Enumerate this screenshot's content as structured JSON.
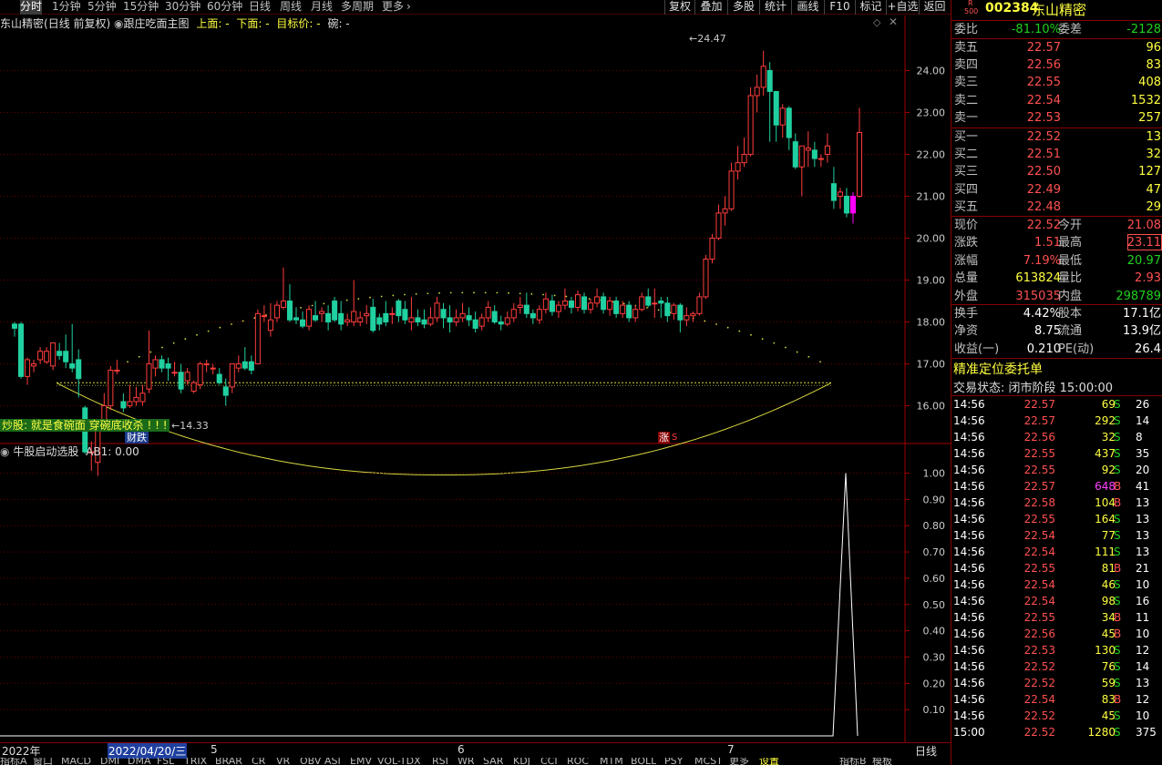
{
  "toolbar": {
    "periods": [
      "分时",
      "1分钟",
      "5分钟",
      "15分钟",
      "30分钟",
      "60分钟",
      "日线",
      "周线",
      "月线",
      "多周期",
      "更多"
    ],
    "buttons": [
      "复权",
      "叠加",
      "多股",
      "统计",
      "画线",
      "F10",
      "标记",
      "+自选",
      "返回"
    ]
  },
  "chart_header": {
    "stock_name": "东山精密",
    "mode": "(日线 前复权)",
    "indicator": "跟庄吃面主图",
    "upper": "上面: -",
    "lower": "下面: -",
    "target": "目标价: -",
    "bowl": "碗: -"
  },
  "chart_data": {
    "type": "candlestick",
    "ylim": [
      15.1,
      24.9
    ],
    "y_ticks": [
      "24.00",
      "23.00",
      "22.00",
      "21.00",
      "20.00",
      "19.00",
      "18.00",
      "17.00",
      "16.00"
    ],
    "y_tick_values": [
      24,
      23,
      22,
      21,
      20,
      19,
      18,
      17,
      16
    ],
    "max_label": "24.47",
    "min_label": "14.33",
    "candles": [
      [
        17.95,
        17.85,
        18.0,
        17.65
      ],
      [
        17.95,
        16.7,
        18.0,
        16.65
      ],
      [
        16.7,
        17.1,
        17.15,
        16.5
      ],
      [
        16.95,
        17.0,
        17.1,
        16.8
      ],
      [
        17.1,
        17.3,
        17.4,
        17.0
      ],
      [
        17.05,
        17.3,
        17.4,
        17.0
      ],
      [
        16.95,
        17.5,
        17.5,
        16.85
      ],
      [
        17.3,
        17.2,
        17.5,
        17.1
      ],
      [
        17.3,
        17.05,
        17.7,
        16.9
      ],
      [
        17.0,
        16.9,
        17.95,
        16.8
      ],
      [
        17.1,
        16.65,
        17.35,
        16.2
      ],
      [
        15.95,
        14.9,
        16.0,
        14.85
      ],
      [
        14.9,
        14.9,
        15.15,
        14.45
      ],
      [
        14.65,
        15.5,
        15.55,
        14.33
      ],
      [
        15.5,
        16.0,
        16.3,
        15.4
      ],
      [
        16.0,
        16.85,
        16.95,
        15.9
      ],
      [
        16.85,
        16.85,
        17.1,
        16.75
      ],
      [
        16.1,
        15.95,
        16.3,
        15.85
      ],
      [
        16.0,
        16.1,
        16.5,
        15.95
      ],
      [
        16.1,
        16.2,
        16.45,
        16.0
      ],
      [
        16.1,
        16.3,
        16.5,
        16.0
      ],
      [
        16.4,
        17.0,
        17.8,
        16.3
      ],
      [
        16.9,
        17.1,
        17.2,
        16.7
      ],
      [
        17.1,
        16.9,
        17.2,
        16.8
      ],
      [
        17.0,
        16.9,
        17.15,
        16.6
      ],
      [
        16.8,
        16.8,
        17.05,
        16.7
      ],
      [
        16.8,
        16.4,
        17.0,
        16.3
      ],
      [
        16.6,
        16.8,
        16.9,
        16.5
      ],
      [
        16.35,
        16.55,
        16.6,
        16.3
      ],
      [
        16.5,
        17.0,
        17.05,
        16.4
      ],
      [
        17.0,
        17.0,
        17.1,
        16.8
      ],
      [
        16.9,
        16.9,
        17.0,
        16.75
      ],
      [
        16.75,
        16.55,
        16.9,
        16.5
      ],
      [
        16.45,
        16.25,
        16.65,
        16.0
      ],
      [
        16.45,
        17.0,
        17.0,
        16.3
      ],
      [
        16.9,
        17.0,
        17.2,
        16.8
      ],
      [
        17.05,
        16.9,
        17.4,
        16.85
      ],
      [
        17.05,
        16.85,
        17.2,
        16.75
      ],
      [
        17.0,
        18.2,
        18.3,
        17.0
      ],
      [
        18.15,
        18.15,
        18.4,
        18.0
      ],
      [
        17.8,
        18.05,
        18.45,
        17.65
      ],
      [
        18.1,
        18.4,
        18.5,
        18.0
      ],
      [
        18.35,
        18.5,
        19.3,
        18.3
      ],
      [
        18.5,
        18.05,
        18.9,
        18.0
      ],
      [
        18.1,
        18.05,
        18.35,
        17.95
      ],
      [
        18.05,
        17.9,
        18.25,
        17.85
      ],
      [
        17.9,
        18.3,
        18.4,
        17.8
      ],
      [
        18.15,
        18.05,
        18.5,
        18.0
      ],
      [
        18.2,
        18.25,
        18.35,
        18.0
      ],
      [
        18.2,
        18.0,
        18.4,
        17.8
      ],
      [
        18.5,
        18.05,
        18.6,
        18.0
      ],
      [
        18.2,
        17.95,
        18.5,
        17.8
      ],
      [
        18.0,
        18.05,
        18.2,
        17.9
      ],
      [
        18.0,
        18.25,
        19.0,
        17.9
      ],
      [
        18.0,
        18.1,
        18.25,
        17.9
      ],
      [
        18.15,
        18.2,
        18.4,
        17.95
      ],
      [
        18.35,
        17.8,
        18.55,
        17.75
      ],
      [
        18.1,
        17.95,
        18.2,
        17.8
      ],
      [
        18.2,
        18.0,
        18.5,
        17.9
      ],
      [
        18.2,
        18.2,
        18.35,
        17.95
      ],
      [
        18.5,
        18.15,
        18.55,
        18.0
      ],
      [
        18.3,
        18.05,
        18.5,
        17.95
      ],
      [
        18.0,
        18.1,
        18.6,
        17.8
      ],
      [
        18.1,
        18.0,
        18.3,
        17.9
      ],
      [
        18.05,
        17.95,
        18.3,
        17.85
      ],
      [
        17.95,
        18.1,
        18.35,
        17.9
      ],
      [
        18.1,
        18.45,
        18.6,
        18.0
      ],
      [
        18.3,
        18.1,
        18.45,
        17.85
      ],
      [
        18.1,
        18.0,
        18.4,
        17.75
      ],
      [
        18.0,
        18.1,
        18.3,
        17.9
      ],
      [
        18.1,
        18.2,
        18.45,
        18.0
      ],
      [
        18.15,
        18.05,
        18.35,
        17.9
      ],
      [
        18.05,
        17.85,
        18.25,
        17.75
      ],
      [
        17.9,
        18.1,
        18.2,
        17.8
      ],
      [
        18.1,
        18.35,
        18.5,
        18.0
      ],
      [
        18.25,
        18.0,
        18.4,
        17.95
      ],
      [
        18.0,
        17.95,
        18.15,
        17.8
      ],
      [
        17.95,
        18.1,
        18.25,
        17.9
      ],
      [
        18.1,
        18.3,
        18.45,
        18.0
      ],
      [
        18.35,
        18.4,
        18.6,
        18.2
      ],
      [
        18.4,
        18.2,
        18.7,
        18.1
      ],
      [
        18.2,
        18.1,
        18.3,
        17.95
      ],
      [
        18.05,
        18.3,
        18.4,
        17.95
      ],
      [
        18.3,
        18.55,
        18.7,
        18.2
      ],
      [
        18.5,
        18.25,
        18.65,
        18.15
      ],
      [
        18.25,
        18.4,
        18.5,
        18.1
      ],
      [
        18.4,
        18.5,
        18.8,
        18.3
      ],
      [
        18.5,
        18.35,
        18.6,
        18.2
      ],
      [
        18.35,
        18.65,
        18.75,
        18.25
      ],
      [
        18.6,
        18.3,
        18.7,
        18.2
      ],
      [
        18.3,
        18.45,
        18.55,
        18.2
      ],
      [
        18.45,
        18.6,
        18.8,
        18.35
      ],
      [
        18.6,
        18.3,
        18.7,
        18.2
      ],
      [
        18.3,
        18.5,
        18.6,
        18.15
      ],
      [
        18.5,
        18.2,
        18.6,
        18.1
      ],
      [
        18.2,
        18.4,
        18.5,
        18.1
      ],
      [
        18.4,
        18.1,
        18.5,
        18.0
      ],
      [
        18.1,
        18.3,
        18.4,
        18.0
      ],
      [
        18.3,
        18.6,
        18.7,
        18.25
      ],
      [
        18.6,
        18.4,
        18.8,
        18.35
      ],
      [
        18.45,
        18.45,
        18.8,
        18.1
      ],
      [
        18.5,
        18.45,
        18.6,
        18.1
      ],
      [
        18.45,
        18.15,
        18.6,
        18.0
      ],
      [
        18.2,
        18.4,
        18.45,
        18.05
      ],
      [
        18.4,
        18.05,
        18.45,
        17.75
      ],
      [
        18.05,
        18.15,
        18.35,
        17.9
      ],
      [
        18.15,
        18.2,
        18.25,
        18.0
      ],
      [
        18.2,
        18.6,
        18.7,
        18.15
      ],
      [
        18.6,
        19.5,
        19.6,
        18.55
      ],
      [
        19.5,
        20.0,
        20.1,
        19.4
      ],
      [
        20.0,
        20.6,
        20.8,
        19.95
      ],
      [
        20.6,
        20.7,
        21.0,
        20.3
      ],
      [
        20.7,
        21.6,
        21.8,
        20.65
      ],
      [
        21.6,
        21.8,
        22.2,
        21.4
      ],
      [
        21.8,
        22.0,
        22.4,
        21.7
      ],
      [
        22.0,
        23.4,
        23.6,
        21.95
      ],
      [
        23.4,
        23.6,
        23.9,
        23.0
      ],
      [
        23.6,
        24.1,
        24.47,
        23.4
      ],
      [
        24.0,
        23.5,
        24.2,
        22.3
      ],
      [
        23.5,
        22.7,
        23.4,
        22.3
      ],
      [
        22.7,
        23.1,
        23.2,
        22.4
      ],
      [
        23.1,
        22.4,
        23.15,
        22.1
      ],
      [
        22.3,
        21.7,
        22.5,
        21.65
      ],
      [
        21.7,
        22.2,
        22.2,
        21.0
      ],
      [
        22.1,
        22.15,
        22.55,
        21.7
      ],
      [
        22.1,
        21.9,
        22.3,
        21.7
      ],
      [
        21.9,
        21.9,
        22.0,
        21.7
      ],
      [
        22.0,
        22.2,
        22.5,
        21.8
      ],
      [
        21.3,
        20.9,
        21.7,
        20.7
      ],
      [
        21.0,
        21.1,
        21.2,
        20.7
      ],
      [
        21.0,
        20.6,
        21.2,
        20.5
      ],
      [
        20.6,
        21.0,
        21.1,
        20.35
      ],
      [
        21.0,
        22.52,
        23.11,
        20.97
      ]
    ]
  },
  "chart_labels": {
    "banner": "炒股: 就是食碗面 穿碗底收杀 ! ! !",
    "caiqi": "财跌",
    "zhang": "涨",
    "s_mark": "S"
  },
  "sub_chart": {
    "title": "牛股启动选股",
    "ab_label": "AB1: 0.00",
    "y_ticks": [
      "1.00",
      "0.90",
      "0.80",
      "0.70",
      "0.60",
      "0.50",
      "0.40",
      "0.30",
      "0.20",
      "0.10"
    ],
    "y_tick_values": [
      1.0,
      0.9,
      0.8,
      0.7,
      0.6,
      0.5,
      0.4,
      0.3,
      0.2,
      0.1
    ],
    "spike_value": 1.0,
    "ylim": [
      0,
      1.04
    ]
  },
  "time_axis": {
    "year": "2022年",
    "date": "2022/04/20/三",
    "months": [
      "5",
      "6",
      "7"
    ],
    "right_label": "日线"
  },
  "indicator_tabs": [
    "指标A",
    "窗口",
    "MACD",
    "DMI",
    "DMA",
    "FSL",
    "TRIX",
    "BRAR",
    "CR",
    "VR",
    "OBV",
    "ASI",
    "EMV",
    "VOL-TDX",
    "RSI",
    "WR",
    "SAR",
    "KDJ",
    "CCI",
    "ROC",
    "MTM",
    "BOLL",
    "PSY",
    "MCST",
    "更多",
    "设置",
    "指标B",
    "模板"
  ],
  "quote": {
    "code": "002384",
    "name": "东山精密",
    "r_label": "R",
    "index_label": "500",
    "weibi_label": "委比",
    "weibi": "-81.10%",
    "weicha_label": "委差",
    "weicha": "-2128",
    "asks": [
      {
        "label": "卖五",
        "price": "22.57",
        "vol": "96"
      },
      {
        "label": "卖四",
        "price": "22.56",
        "vol": "83"
      },
      {
        "label": "卖三",
        "price": "22.55",
        "vol": "408"
      },
      {
        "label": "卖二",
        "price": "22.54",
        "vol": "1532"
      },
      {
        "label": "卖一",
        "price": "22.53",
        "vol": "257"
      }
    ],
    "bids": [
      {
        "label": "买一",
        "price": "22.52",
        "vol": "13"
      },
      {
        "label": "买二",
        "price": "22.51",
        "vol": "32"
      },
      {
        "label": "买三",
        "price": "22.50",
        "vol": "127"
      },
      {
        "label": "买四",
        "price": "22.49",
        "vol": "47"
      },
      {
        "label": "买五",
        "price": "22.48",
        "vol": "29"
      }
    ],
    "stats": [
      {
        "l1": "现价",
        "v1": "22.52",
        "c1": "red",
        "l2": "今开",
        "v2": "21.08",
        "c2": "red"
      },
      {
        "l1": "涨跌",
        "v1": "1.51",
        "c1": "red",
        "l2": "最高",
        "v2": "23.11",
        "c2": "red"
      },
      {
        "l1": "涨幅",
        "v1": "7.19%",
        "c1": "red",
        "l2": "最低",
        "v2": "20.97",
        "c2": "green"
      },
      {
        "l1": "总量",
        "v1": "613824",
        "c1": "yellow",
        "l2": "量比",
        "v2": "2.93",
        "c2": "red"
      },
      {
        "l1": "外盘",
        "v1": "315035",
        "c1": "red",
        "l2": "内盘",
        "v2": "298789",
        "c2": "green"
      }
    ],
    "stats2": [
      {
        "l1": "换手",
        "v1": "4.42%",
        "l2": "股本",
        "v2": "17.1亿"
      },
      {
        "l1": "净资",
        "v1": "8.75",
        "l2": "流通",
        "v2": "13.9亿"
      },
      {
        "l1": "收益(一)",
        "v1": "0.210",
        "l2": "PE(动)",
        "v2": "26.4"
      }
    ],
    "section_title": "精准定位委托单",
    "trade_state": "交易状态: 闭市阶段 15:00:00"
  },
  "ticks": [
    {
      "t": "14:56",
      "p": "22.57",
      "v": "69",
      "d": "S",
      "n": "26"
    },
    {
      "t": "14:56",
      "p": "22.57",
      "v": "292",
      "d": "S",
      "n": "14"
    },
    {
      "t": "14:56",
      "p": "22.56",
      "v": "32",
      "d": "S",
      "n": "8"
    },
    {
      "t": "14:56",
      "p": "22.55",
      "v": "437",
      "d": "S",
      "n": "35"
    },
    {
      "t": "14:56",
      "p": "22.55",
      "v": "92",
      "d": "S",
      "n": "20"
    },
    {
      "t": "14:56",
      "p": "22.57",
      "v": "648",
      "d": "B",
      "n": "41"
    },
    {
      "t": "14:56",
      "p": "22.58",
      "v": "104",
      "d": "B",
      "n": "13"
    },
    {
      "t": "14:56",
      "p": "22.55",
      "v": "164",
      "d": "S",
      "n": "13"
    },
    {
      "t": "14:56",
      "p": "22.54",
      "v": "77",
      "d": "S",
      "n": "13"
    },
    {
      "t": "14:56",
      "p": "22.54",
      "v": "111",
      "d": "S",
      "n": "13"
    },
    {
      "t": "14:56",
      "p": "22.55",
      "v": "81",
      "d": "B",
      "n": "21"
    },
    {
      "t": "14:56",
      "p": "22.54",
      "v": "46",
      "d": "S",
      "n": "10"
    },
    {
      "t": "14:56",
      "p": "22.54",
      "v": "98",
      "d": "S",
      "n": "16"
    },
    {
      "t": "14:56",
      "p": "22.55",
      "v": "34",
      "d": "B",
      "n": "11"
    },
    {
      "t": "14:56",
      "p": "22.56",
      "v": "45",
      "d": "B",
      "n": "10"
    },
    {
      "t": "14:56",
      "p": "22.53",
      "v": "130",
      "d": "S",
      "n": "12"
    },
    {
      "t": "14:56",
      "p": "22.52",
      "v": "76",
      "d": "S",
      "n": "14"
    },
    {
      "t": "14:56",
      "p": "22.52",
      "v": "59",
      "d": "S",
      "n": "13"
    },
    {
      "t": "14:56",
      "p": "22.54",
      "v": "83",
      "d": "B",
      "n": "12"
    },
    {
      "t": "14:56",
      "p": "22.52",
      "v": "45",
      "d": "S",
      "n": "10"
    },
    {
      "t": "15:00",
      "p": "22.52",
      "v": "1280",
      "d": "S",
      "n": "375"
    }
  ],
  "colors": {
    "up": "#ff3c3c",
    "down": "#20d0a0",
    "grid": "#6a0000",
    "bowl": "#d8d840",
    "highlight": "#ff00ff"
  }
}
